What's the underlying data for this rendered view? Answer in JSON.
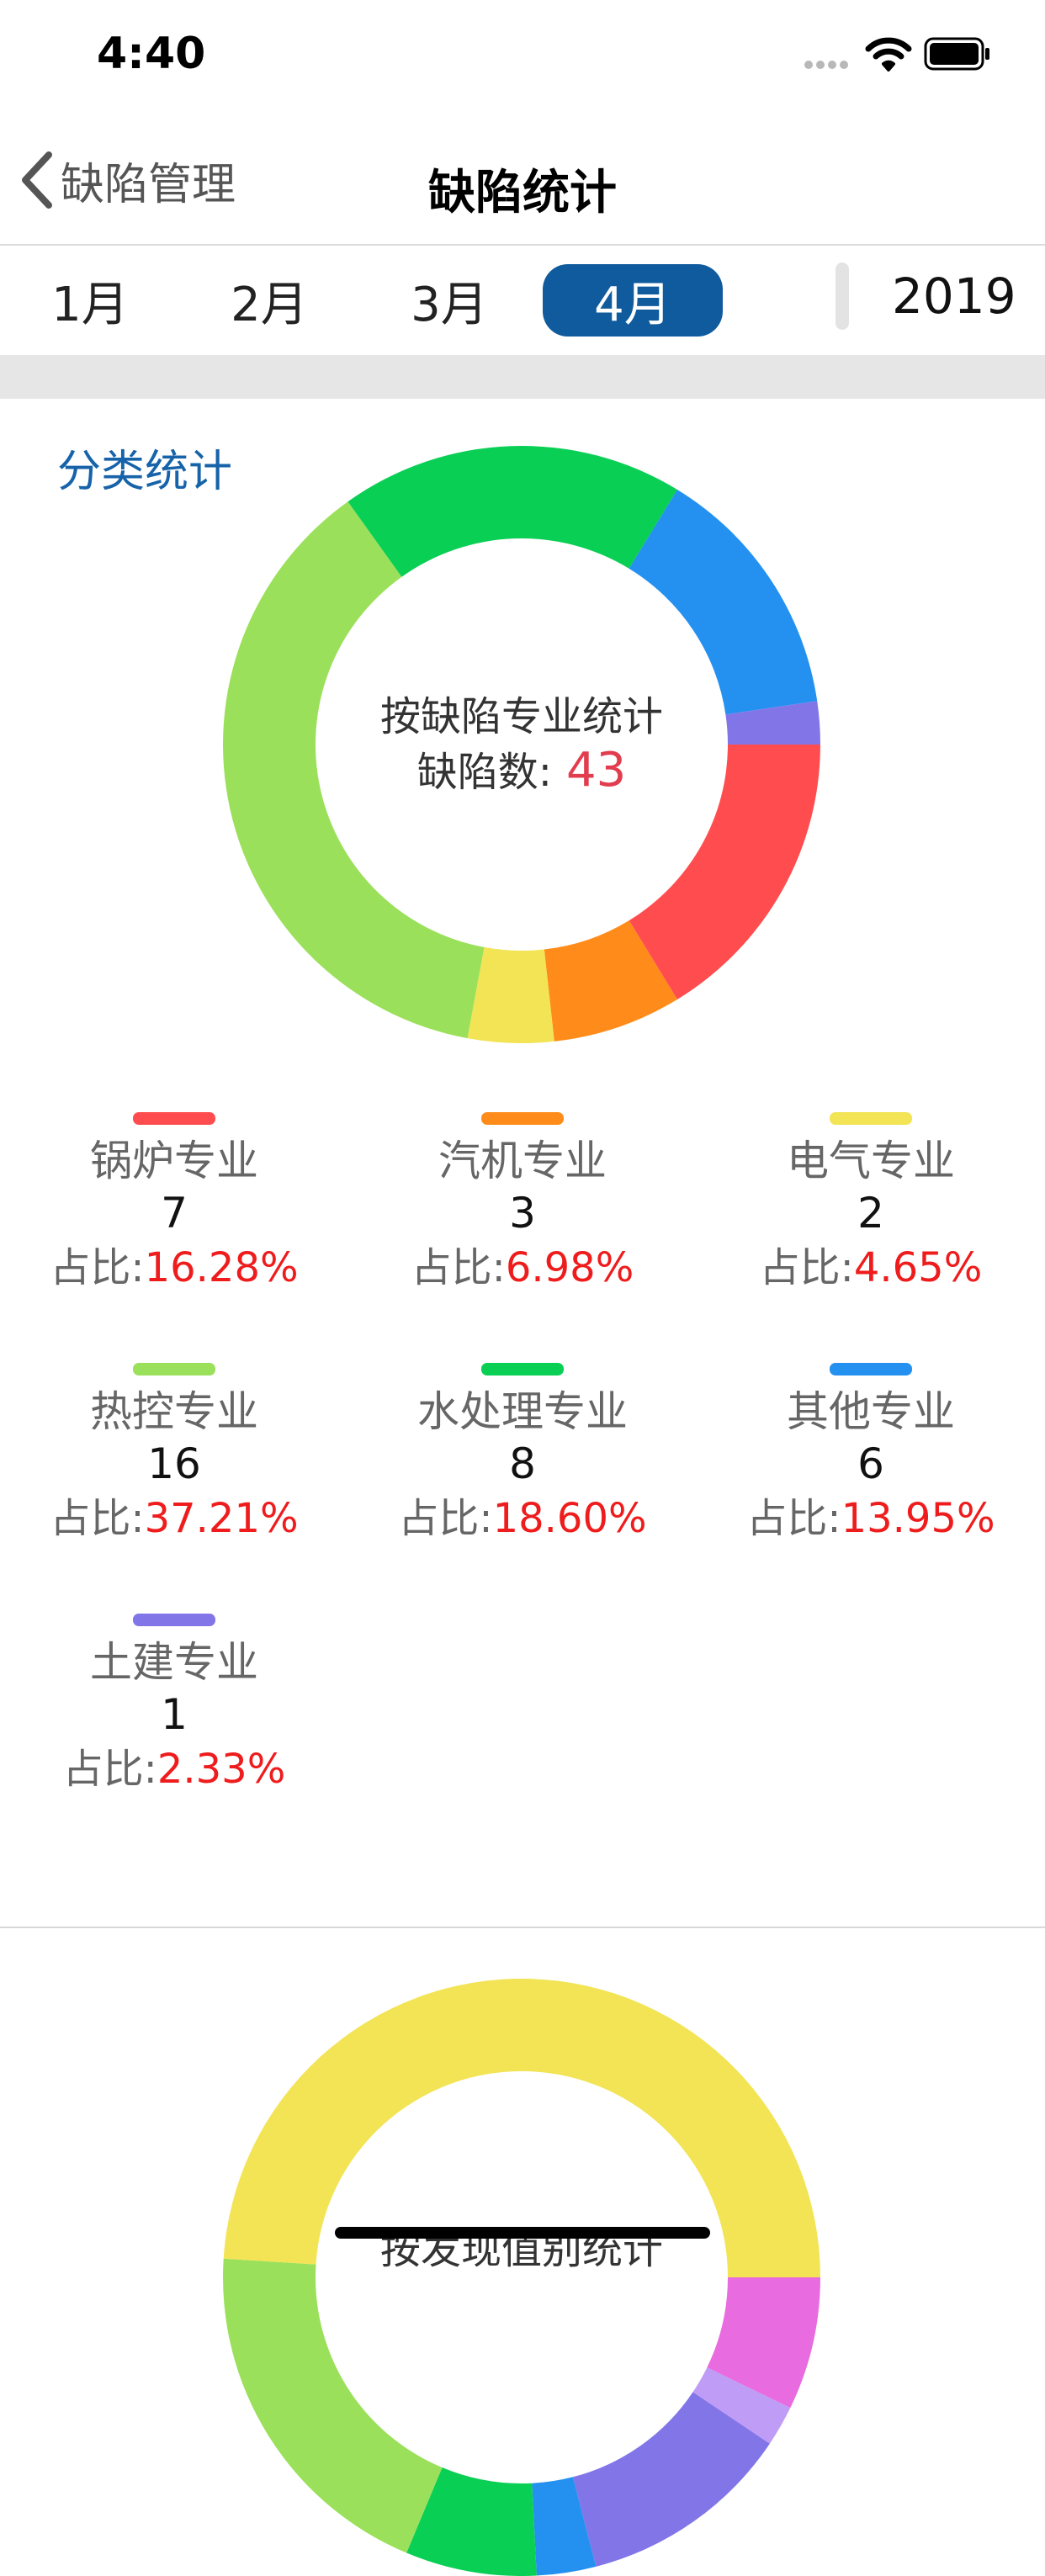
{
  "status_bar": {
    "time": "4:40"
  },
  "nav": {
    "back_label": "缺陷管理",
    "title": "缺陷统计"
  },
  "months": [
    {
      "label": "1月",
      "active": false
    },
    {
      "label": "2月",
      "active": false
    },
    {
      "label": "3月",
      "active": false
    },
    {
      "label": "4月",
      "active": true
    }
  ],
  "year": "2019",
  "section1": {
    "title": "分类统计",
    "center_line1": "按缺陷专业统计",
    "center_line2_label": "缺陷数:",
    "center_count": "43",
    "ratio_label": "占比:"
  },
  "chart_data": [
    {
      "type": "pie",
      "title": "按缺陷专业统计",
      "total": 43,
      "series": [
        {
          "name": "锅炉专业",
          "value": 7,
          "percent": "16.28%",
          "color": "#ff4d4f"
        },
        {
          "name": "汽机专业",
          "value": 3,
          "percent": "6.98%",
          "color": "#ff8c1a"
        },
        {
          "name": "电气专业",
          "value": 2,
          "percent": "4.65%",
          "color": "#f2e455"
        },
        {
          "name": "热控专业",
          "value": 16,
          "percent": "37.21%",
          "color": "#9be05a"
        },
        {
          "name": "水处理专业",
          "value": 8,
          "percent": "18.60%",
          "color": "#0acf55"
        },
        {
          "name": "其他专业",
          "value": 6,
          "percent": "13.95%",
          "color": "#2491f0"
        },
        {
          "name": "土建专业",
          "value": 1,
          "percent": "2.33%",
          "color": "#8275e8"
        }
      ]
    },
    {
      "type": "pie",
      "title": "按发现值别统计",
      "series": [
        {
          "value": 0.072,
          "color": "#e86be0"
        },
        {
          "value": 0.022,
          "color": "#bf9cf5"
        },
        {
          "value": 0.116,
          "color": "#8275e8"
        },
        {
          "value": 0.032,
          "color": "#2491f0"
        },
        {
          "value": 0.071,
          "color": "#0acf55"
        },
        {
          "value": 0.197,
          "color": "#9be05a"
        },
        {
          "value": 0.49,
          "color": "#f2e455"
        }
      ]
    }
  ]
}
